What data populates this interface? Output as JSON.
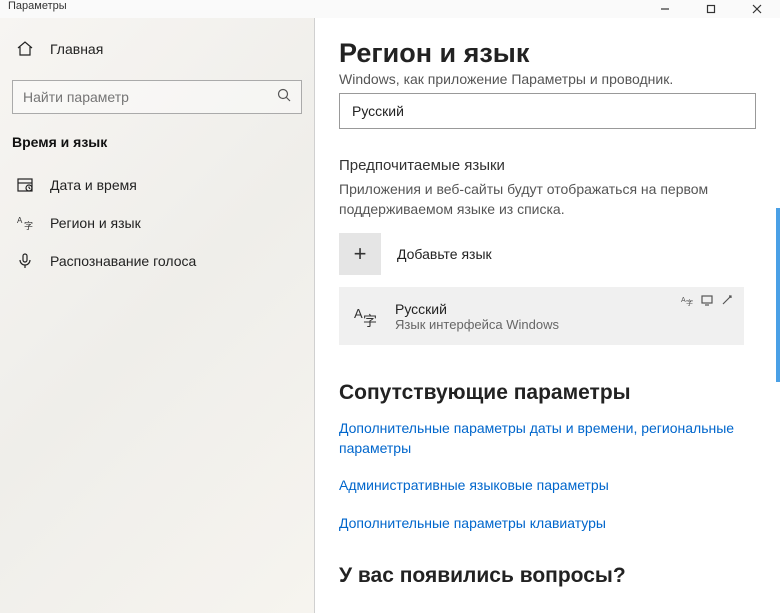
{
  "window": {
    "title": "Параметры"
  },
  "sidebar": {
    "home": "Главная",
    "search_placeholder": "Найти параметр",
    "section": "Время и язык",
    "items": [
      {
        "label": "Дата и время"
      },
      {
        "label": "Регион и язык"
      },
      {
        "label": "Распознавание голоса"
      }
    ]
  },
  "main": {
    "title": "Регион и язык",
    "clipped_desc": "Windows, как приложение  Параметры  и проводник.",
    "dropdown_value": "Русский",
    "pref_langs_heading": "Предпочитаемые языки",
    "pref_langs_desc": "Приложения и веб-сайты будут отображаться на первом поддерживаемом языке из списка.",
    "add_language": "Добавьте язык",
    "language_tile": {
      "name": "Русский",
      "sub": "Язык интерфейса Windows"
    },
    "related_heading": "Сопутствующие параметры",
    "links": [
      "Дополнительные параметры даты и времени, региональные параметры",
      "Административные языковые параметры",
      "Дополнительные параметры клавиатуры"
    ],
    "questions_heading": "У вас появились вопросы?"
  }
}
